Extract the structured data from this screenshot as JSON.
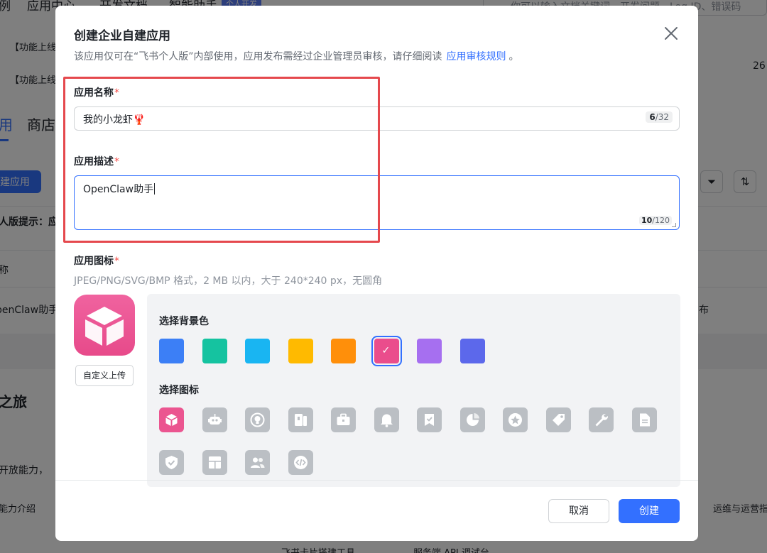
{
  "background": {
    "nav": [
      "例",
      "应用中心",
      "开发文档",
      "智能助手"
    ],
    "nav_badge": "个人开发",
    "search_placeholder": "你可以输入文档关键词、开发问题、Log ID、错误码",
    "row1": "【功能上线】",
    "row2": "【功能上线",
    "row2_count": "26",
    "tab_left": "用",
    "tab_store": "商店",
    "create_button": "建应用",
    "filter_icon": "funnel-icon",
    "sort_icon": "sort-icon",
    "notice": "人版提示：应",
    "col_name": "称",
    "app_row_name": "penClaw助手",
    "app_row_status": "布",
    "journey_title": "之旅",
    "capability_desc": "开放能力，",
    "capability_intro": "能力介绍",
    "ops_link": "运维与运营指",
    "tool1": "飞书卡片搭建工具",
    "tool2": "服务端 API 调试台"
  },
  "modal": {
    "title": "创建企业自建应用",
    "subtitle": "该应用仅可在“飞书个人版”内部使用，应用发布需经过企业管理员审核，请仔细阅读",
    "subtitle_link": "应用审核规则",
    "subtitle_end": "。",
    "close_icon": "close-icon",
    "name_field": {
      "label": "应用名称",
      "required": "*",
      "value": "我的小龙虾🦞",
      "count": "6",
      "max": "/32"
    },
    "desc_field": {
      "label": "应用描述",
      "required": "*",
      "value": "OpenClaw助手",
      "count": "10",
      "max": "/120"
    },
    "icon_field": {
      "label": "应用图标",
      "required": "*",
      "hint": "JPEG/PNG/SVG/BMP 格式，2 MB 以内，大于 240*240 px，无圆角",
      "preview_icon": "cube-icon",
      "upload_label": "自定义上传"
    },
    "bg_colors": {
      "label": "选择背景色",
      "colors": [
        "#3c7ff6",
        "#15c3a0",
        "#19b5f2",
        "#ffba00",
        "#ff8f0a",
        "#ea4d8c",
        "#a66ff0",
        "#5c68eb"
      ],
      "selected_index": 5
    },
    "icons": {
      "label": "选择图标",
      "names": [
        "cube-icon",
        "robot-icon",
        "bulb-icon",
        "book-icon",
        "briefcase-icon",
        "bell-icon",
        "bookmark-icon",
        "pie-chart-icon",
        "star-icon",
        "tag-icon",
        "wrench-icon",
        "document-icon",
        "shield-icon",
        "layout-icon",
        "users-icon",
        "code-icon"
      ],
      "selected_index": 0
    },
    "footer": {
      "cancel_label": "取消",
      "create_label": "创建"
    }
  },
  "colors": {
    "accent": "#3370ff",
    "required": "#f54a45",
    "highlight": "#e5484d",
    "icon_disabled": "#bbbfc4"
  }
}
